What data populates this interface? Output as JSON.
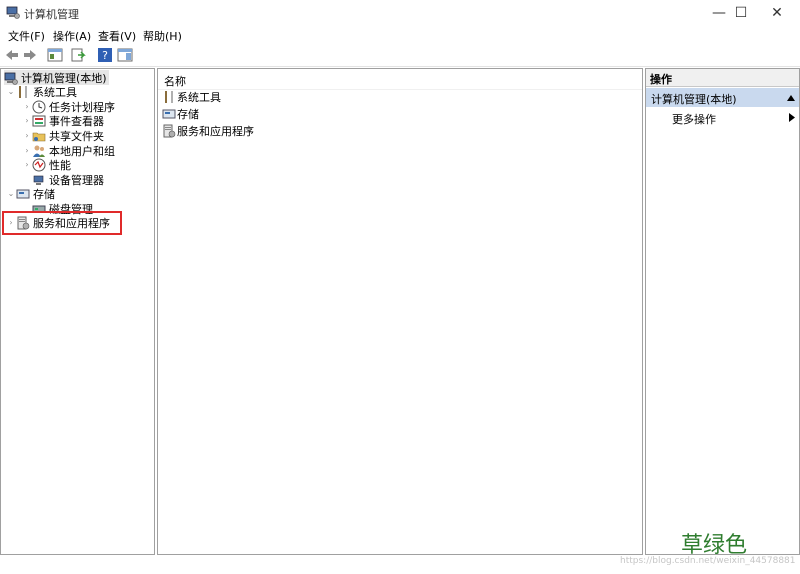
{
  "window": {
    "title": "计算机管理",
    "minimize": "—",
    "maximize": "☐",
    "close": "✕"
  },
  "menu": [
    "文件(F)",
    "操作(A)",
    "查看(V)",
    "帮助(H)"
  ],
  "toolbar": {
    "back": "back-arrow-icon",
    "forward": "forward-arrow-icon",
    "help": "?"
  },
  "tree": {
    "root": "计算机管理(本地)",
    "items": [
      {
        "label": "系统工具",
        "expanded": true
      },
      {
        "label": "任务计划程序"
      },
      {
        "label": "事件查看器"
      },
      {
        "label": "共享文件夹"
      },
      {
        "label": "本地用户和组"
      },
      {
        "label": "性能"
      },
      {
        "label": "设备管理器"
      },
      {
        "label": "存储",
        "expanded": true
      },
      {
        "label": "磁盘管理"
      },
      {
        "label": "服务和应用程序"
      }
    ]
  },
  "content": {
    "column_header": "名称",
    "rows": [
      "系统工具",
      "存储",
      "服务和应用程序"
    ]
  },
  "actions": {
    "header": "操作",
    "section": "计算机管理(本地)",
    "more": "更多操作"
  },
  "overlay": {
    "watermark": "草绿色",
    "url": "https://blog.csdn.net/weixin_44578881"
  },
  "colors": {
    "highlight_box": "#e02a2a",
    "actions_section_bg": "#c9d9ee",
    "watermark": "#2f7d2f"
  }
}
